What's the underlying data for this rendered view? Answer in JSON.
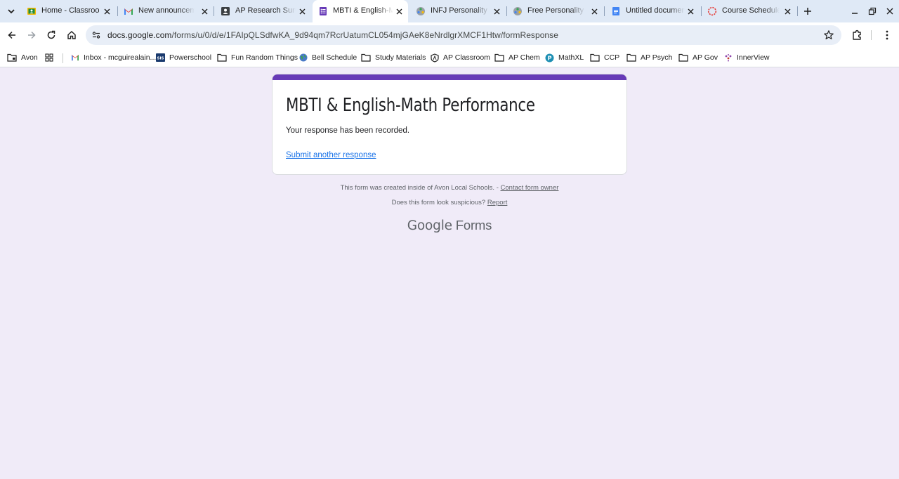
{
  "browser": {
    "tabs": [
      {
        "title": "Home - Classroom",
        "icon": "classroom-icon"
      },
      {
        "title": "New announcement",
        "icon": "gmail-icon"
      },
      {
        "title": "AP Research Survey",
        "icon": "contact-card-icon"
      },
      {
        "title": "MBTI & English-Math",
        "icon": "google-forms-icon",
        "active": true
      },
      {
        "title": "INFJ Personality (A",
        "icon": "personality-test-icon"
      },
      {
        "title": "Free Personality Te",
        "icon": "personality-test-icon"
      },
      {
        "title": "Untitled document",
        "icon": "google-docs-icon"
      },
      {
        "title": "Course Schedule: ",
        "icon": "loading-spinner-icon"
      }
    ],
    "url": {
      "host": "docs.google.com",
      "path": "/forms/u/0/d/e/1FAIpQLSdfwKA_9d94qm7RcrUatumCL054mjGAeK8eNrdlgrXMCF1Htw/formResponse"
    },
    "bookmarks": [
      {
        "label": "Avon",
        "icon": "folder-managed-icon"
      },
      {
        "label": "",
        "icon": "apps-grid-icon"
      },
      {
        "label": "Inbox - mcguirealain...",
        "icon": "gmail-icon"
      },
      {
        "label": "Powerschool",
        "icon": "powerschool-icon"
      },
      {
        "label": "Fun Random Things",
        "icon": "folder-icon"
      },
      {
        "label": "Bell Schedule",
        "icon": "globe-icon"
      },
      {
        "label": "Study Materials",
        "icon": "folder-icon"
      },
      {
        "label": "AP Classroom",
        "icon": "ap-shield-icon"
      },
      {
        "label": "AP Chem",
        "icon": "folder-icon"
      },
      {
        "label": "MathXL",
        "icon": "mathxl-icon"
      },
      {
        "label": "CCP",
        "icon": "folder-icon"
      },
      {
        "label": "AP Psych",
        "icon": "folder-icon"
      },
      {
        "label": "AP Gov",
        "icon": "folder-icon"
      },
      {
        "label": "InnerView",
        "icon": "innerview-icon"
      }
    ],
    "colors": {
      "tabstrip": "#dfe9f6",
      "omnibox": "#e8eef7"
    }
  },
  "form": {
    "title": "MBTI & English-Math Performance",
    "confirmation": "Your response has been recorded.",
    "submit_another": "Submit another response",
    "accent_color": "#673ab7",
    "background_color": "#f0ebf8"
  },
  "footer": {
    "created_text": "This form was created inside of Avon Local Schools. - ",
    "contact_link": "Contact form owner",
    "suspicious_text": "Does this form look suspicious? ",
    "report_link": "Report",
    "brand_google": "Google",
    "brand_forms": " Forms"
  }
}
